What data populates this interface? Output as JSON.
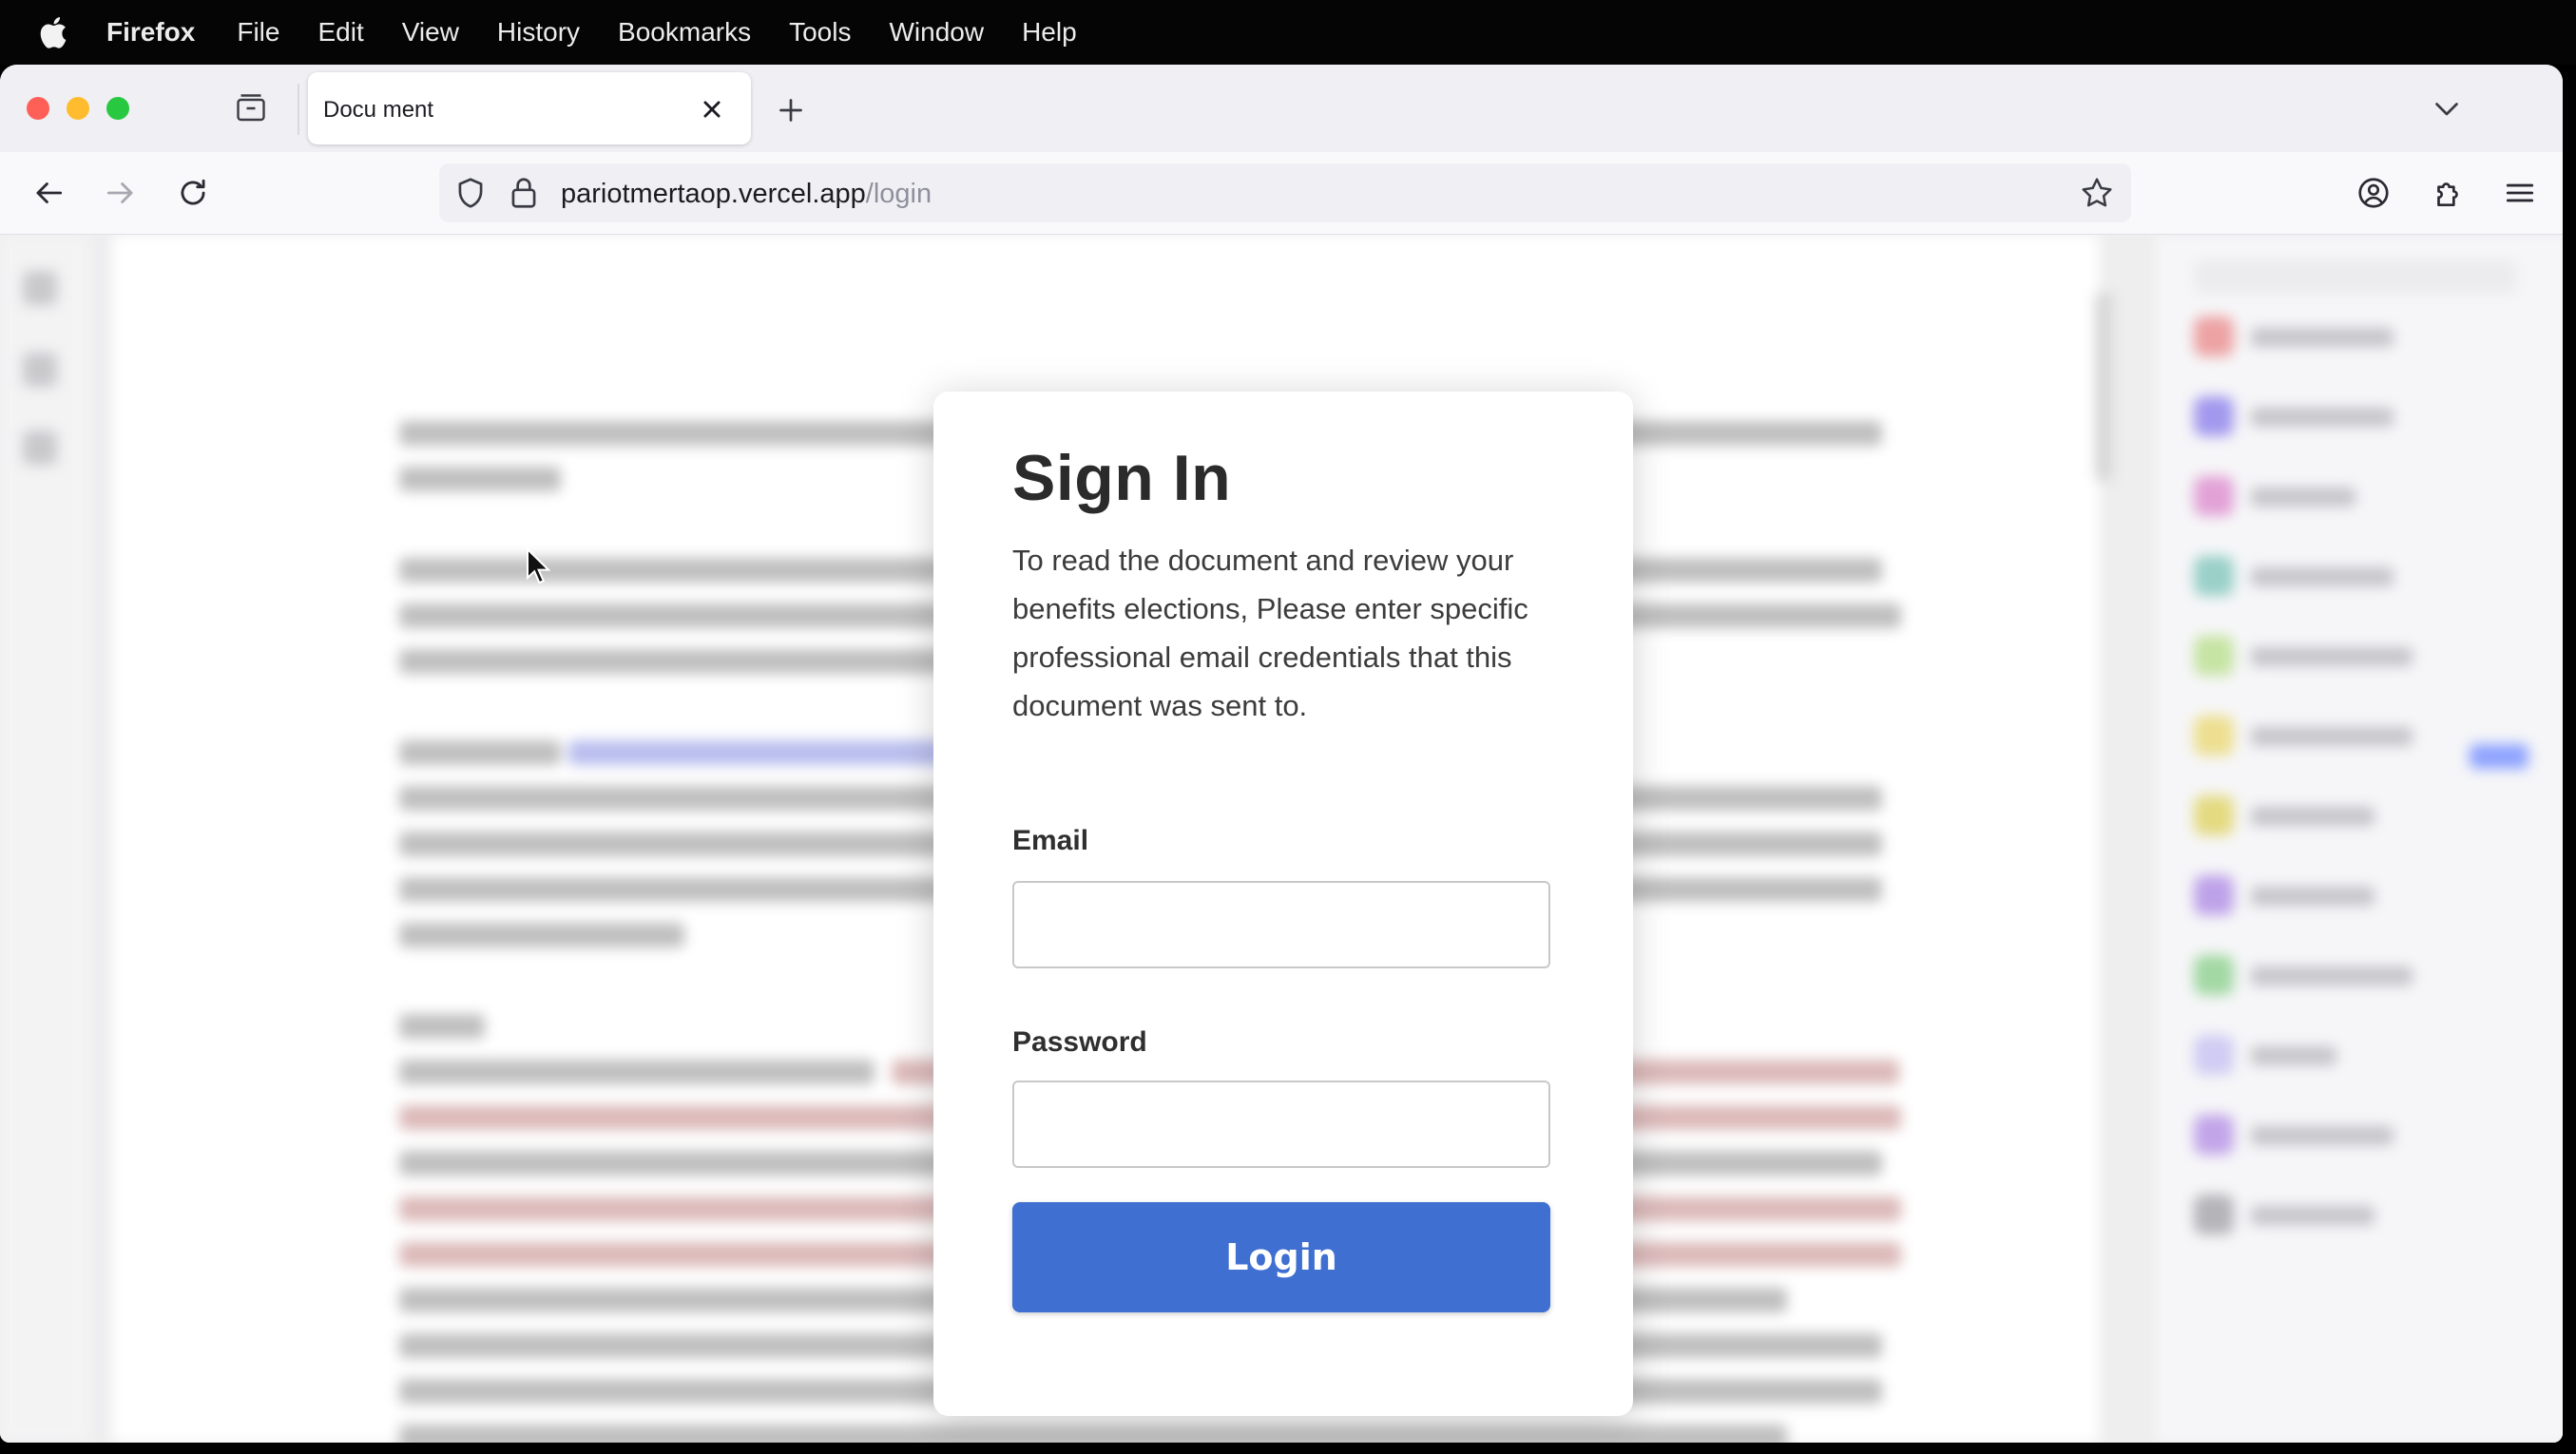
{
  "menubar": {
    "app": "Firefox",
    "items": [
      "File",
      "Edit",
      "View",
      "History",
      "Bookmarks",
      "Tools",
      "Window",
      "Help"
    ]
  },
  "browser": {
    "tab_title": "Docu ment",
    "url_host": "pariotmertaop.vercel.app",
    "url_path": "/login"
  },
  "signin": {
    "title": "Sign In",
    "description": "To read the document and review your benefits elections, Please enter specific professional email credentials that this document was sent to.",
    "email_label": "Email",
    "email_value": "",
    "password_label": "Password",
    "password_value": "",
    "login_label": "Login"
  },
  "colors": {
    "login_button": "#3f6fd1",
    "traffic_close": "#fe5f57",
    "traffic_minimize": "#febc2e",
    "traffic_maximize": "#28c840"
  },
  "icons": [
    "apple-icon",
    "tab-overview-icon",
    "close-icon",
    "plus-icon",
    "chevron-down-icon",
    "back-arrow-icon",
    "forward-arrow-icon",
    "reload-icon",
    "shield-icon",
    "lock-icon",
    "star-icon",
    "account-icon",
    "extensions-icon",
    "hamburger-menu-icon",
    "mouse-cursor-icon"
  ]
}
